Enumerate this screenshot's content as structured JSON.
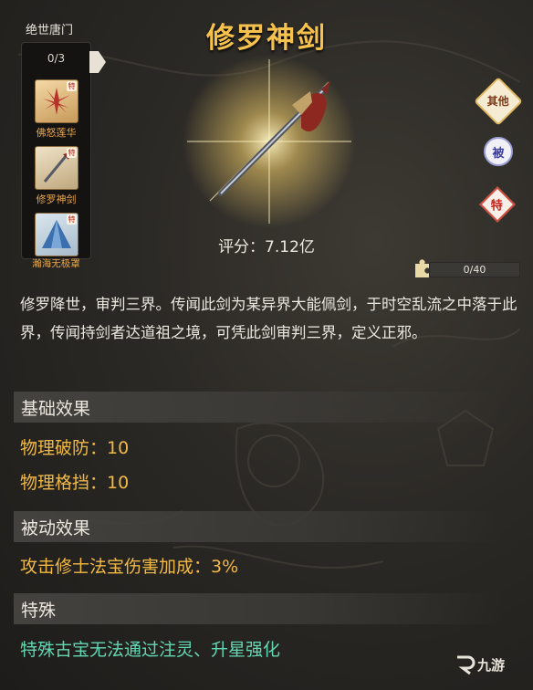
{
  "set": {
    "name": "绝世唐门",
    "count": "0/3",
    "items": [
      {
        "label": "佛怒莲华",
        "tag": "特"
      },
      {
        "label": "修罗神剑",
        "tag": "特"
      },
      {
        "label": "瀚海无极罩",
        "tag": "特"
      }
    ]
  },
  "item": {
    "title": "修罗神剑",
    "score": "评分：7.12亿",
    "progress_text": "0/40",
    "progress_fraction": 0,
    "description": "修罗降世，审判三界。传闻此剑为某异界大能佩剑，于时空乱流之中落于此界，传闻持剑者达道祖之境，可凭此剑审判三界，定义正邪。"
  },
  "tags": {
    "other": "其他",
    "passive": "被",
    "special": "特"
  },
  "sections": {
    "basic": {
      "title": "基础效果",
      "lines": [
        "物理破防：10",
        "物理格挡：10"
      ]
    },
    "passive": {
      "title": "被动效果",
      "lines": [
        "攻击修士法宝伤害加成：3%"
      ]
    },
    "special": {
      "title": "特殊",
      "lines": [
        "特殊古宝无法通过注灵、升星强化"
      ]
    }
  },
  "watermark": "九游",
  "colors": {
    "title": "#f6c14c",
    "effect": "#f2b944",
    "special": "#63d7b4"
  }
}
